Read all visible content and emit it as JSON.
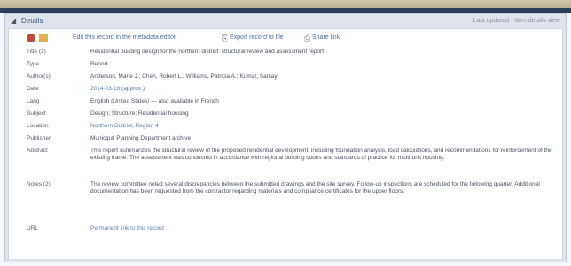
{
  "header": {
    "title": "Details",
    "right_text": "Last updated · Item details view"
  },
  "toolbar": {
    "link_edit": "Edit this record in the metadata editor",
    "link_export": "Export record to file",
    "link_share": "Share link"
  },
  "rows": [
    {
      "label": "Title (1)",
      "value": "Residential building design for the northern district: structural review and assessment report",
      "link": false
    },
    {
      "label": "Type",
      "value": "Report",
      "link": false
    },
    {
      "label": "Author(s)",
      "value": "Anderson, Marie J.; Chen, Robert L.; Williams, Patricia A.; Kumar, Sanjay",
      "link": false
    },
    {
      "label": "Date",
      "value": "2014-03-18 (approx.)",
      "link": true
    },
    {
      "label": "Lang",
      "value": "English (United States) — also available in French",
      "link": false
    },
    {
      "label": "Subject",
      "value": "Design; Structure; Residential housing",
      "link": false
    },
    {
      "label": "Location",
      "value": "Northern District, Region 4",
      "link": true
    },
    {
      "label": "Publisher",
      "value": "Municipal Planning Department archive",
      "link": false
    },
    {
      "label": "Abstract",
      "value": "This report summarizes the structural review of the proposed residential development, including foundation analysis, load calculations, and recommendations for reinforcement of the existing frame. The assessment was conducted in accordance with regional building codes and standards of practice for multi-unit housing.",
      "link": false
    },
    {
      "label": "Notes (2)",
      "value": "The review committee noted several discrepancies between the submitted drawings and the site survey. Follow-up inspections are scheduled for the following quarter. Additional documentation has been requested from the contractor regarding materials and compliance certificates for the upper floors.",
      "link": false
    },
    {
      "label": "URL",
      "value": "Permanent link to this record",
      "link": true
    }
  ]
}
